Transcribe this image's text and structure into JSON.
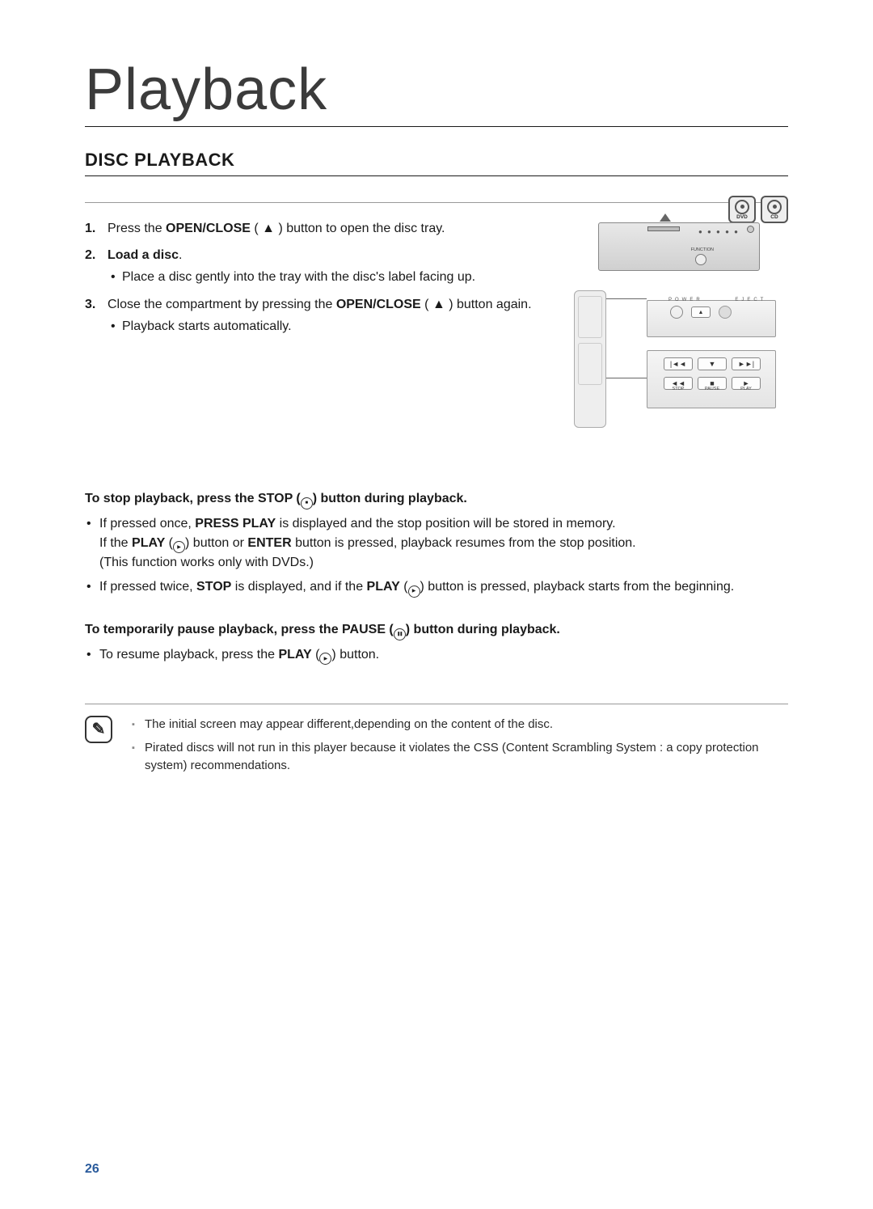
{
  "header": {
    "main_title": "Playback",
    "section_title": "DISC PLAYBACK"
  },
  "disc_icons": [
    {
      "label": "DVD"
    },
    {
      "label": "CD"
    }
  ],
  "steps": [
    {
      "prefix": "Press the ",
      "bold": "OPEN/CLOSE",
      "suffix": " ( ▲ ) button to open the disc tray.",
      "sub": null
    },
    {
      "bold_full": "Load a disc",
      "suffix": ".",
      "sub": "Place a disc gently into the tray with the disc's label facing up."
    },
    {
      "prefix": "Close the compartment by pressing the ",
      "bold": "OPEN/CLOSE",
      "suffix": " ( ▲ ) button again.",
      "sub": "Playback starts automatically."
    }
  ],
  "player_labels": {
    "function": "FUNCTION",
    "dots": "● ● ● ● ●"
  },
  "remote_labels": {
    "power": "POWER",
    "eject": "EJECT",
    "stop": "STOP",
    "pause": "PAUSE",
    "play": "PLAY"
  },
  "stop_section": {
    "heading_parts": [
      "To stop playback, press the ",
      "STOP",
      " (",
      ") button during playback."
    ],
    "b1_parts": [
      "If pressed once, ",
      "PRESS PLAY",
      " is displayed and the stop position will be stored in memory."
    ],
    "b1b_parts": [
      "If the ",
      "PLAY",
      " (",
      ") button or ",
      "ENTER",
      " button is pressed, playback resumes from the stop position."
    ],
    "b1c": "(This function works only with DVDs.)",
    "b2_parts": [
      "If pressed twice, ",
      "STOP",
      " is displayed, and if the ",
      "PLAY",
      " (",
      ") button is pressed, playback starts from the beginning."
    ]
  },
  "pause_section": {
    "heading_parts": [
      "To temporarily pause playback, press the ",
      "PAUSE (",
      ") button during playback."
    ],
    "b1_parts": [
      "To resume playback, press the ",
      "PLAY",
      " (",
      ") button."
    ]
  },
  "notes": [
    "The initial screen may appear different,depending on the content of the disc.",
    "Pirated discs will not run in this player because it violates the CSS (Content Scrambling System : a copy protection system) recommendations."
  ],
  "page_number": "26"
}
